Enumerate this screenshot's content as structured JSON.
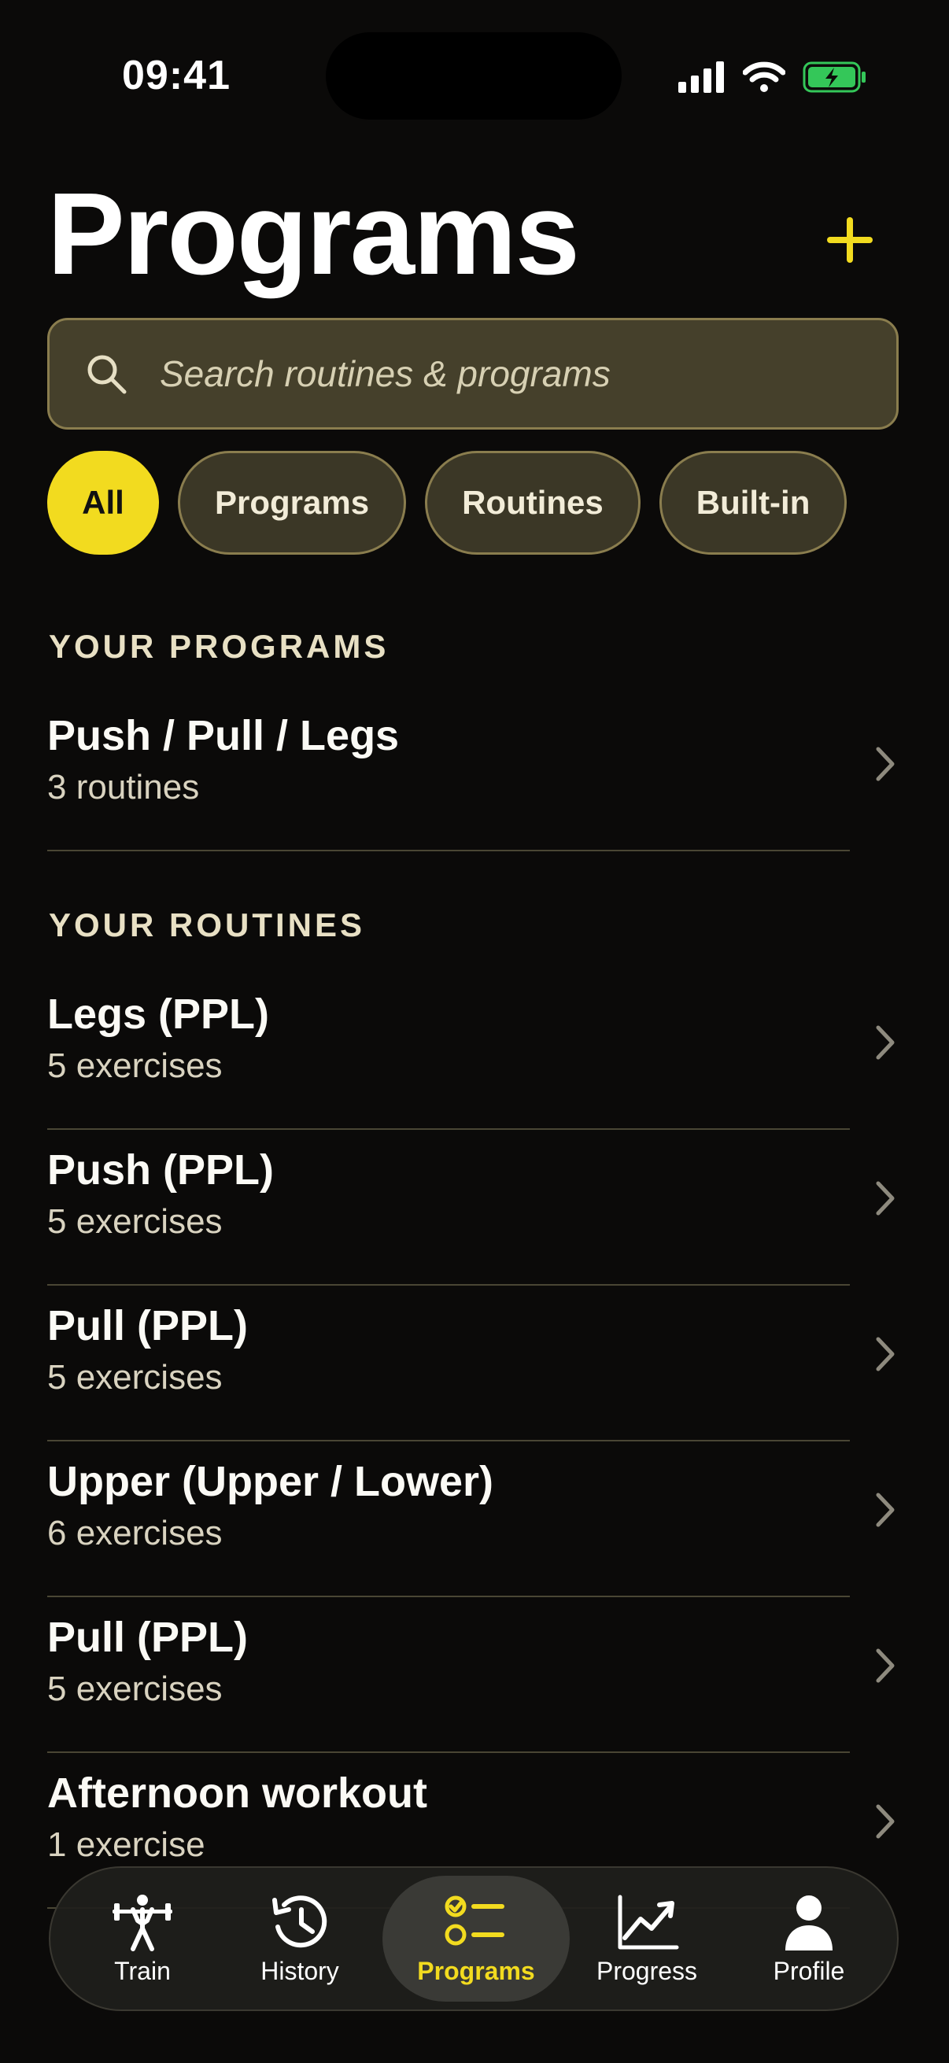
{
  "status": {
    "time": "09:41"
  },
  "header": {
    "title": "Programs",
    "add_icon": "plus-icon"
  },
  "search": {
    "placeholder": "Search routines & programs",
    "icon": "search-icon"
  },
  "filters": [
    {
      "label": "All",
      "active": true
    },
    {
      "label": "Programs",
      "active": false
    },
    {
      "label": "Routines",
      "active": false
    },
    {
      "label": "Built-in",
      "active": false
    }
  ],
  "sections": {
    "programs": {
      "title": "YOUR PROGRAMS",
      "items": [
        {
          "title": "Push / Pull / Legs",
          "subtitle": "3 routines"
        }
      ]
    },
    "routines": {
      "title": "YOUR ROUTINES",
      "items": [
        {
          "title": "Legs (PPL)",
          "subtitle": "5 exercises"
        },
        {
          "title": "Push (PPL)",
          "subtitle": "5 exercises"
        },
        {
          "title": "Pull (PPL)",
          "subtitle": "5 exercises"
        },
        {
          "title": "Upper (Upper / Lower)",
          "subtitle": "6 exercises"
        },
        {
          "title": "Pull (PPL)",
          "subtitle": "5 exercises"
        },
        {
          "title": "Afternoon workout",
          "subtitle": "1 exercise"
        }
      ]
    }
  },
  "tabbar": {
    "items": [
      {
        "label": "Train",
        "icon": "weightlifter-icon"
      },
      {
        "label": "History",
        "icon": "history-icon"
      },
      {
        "label": "Programs",
        "icon": "checklist-icon",
        "active": true
      },
      {
        "label": "Progress",
        "icon": "chart-icon"
      },
      {
        "label": "Profile",
        "icon": "person-icon"
      }
    ]
  },
  "colors": {
    "accent": "#f2db1f",
    "background": "#0b0a09",
    "field": "#45402b",
    "battery": "#34c759"
  }
}
